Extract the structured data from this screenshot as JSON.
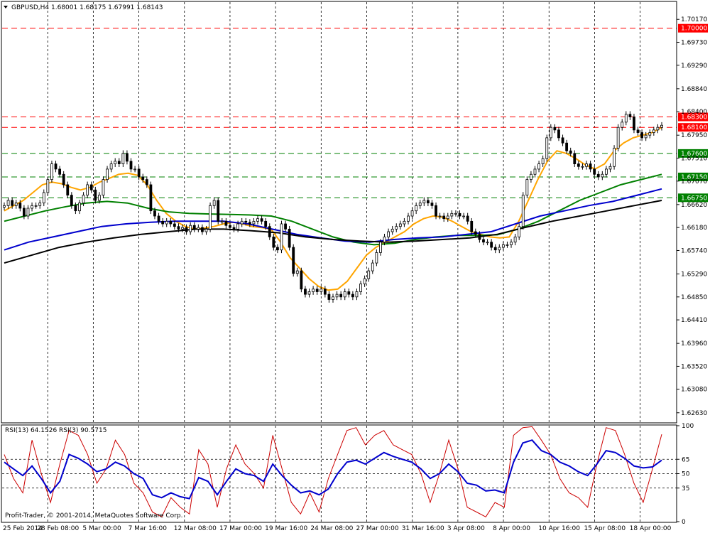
{
  "chart_data": [
    {
      "type": "candlestick",
      "title": "GBPUSD,H4  1.68001 1.68175 1.67991 1.68143",
      "symbol": "GBPUSD",
      "timeframe": "H4",
      "last_bar": {
        "open": 1.68001,
        "high": 1.68175,
        "low": 1.67991,
        "close": 1.68143
      },
      "ylim": [
        1.6245,
        1.705
      ],
      "y_ticks": [
        "1.70170",
        "1.69730",
        "1.69290",
        "1.68840",
        "1.68400",
        "1.67950",
        "1.67510",
        "1.67070",
        "1.66620",
        "1.66180",
        "1.65740",
        "1.65290",
        "1.64850",
        "1.64410",
        "1.63960",
        "1.63520",
        "1.63080",
        "1.62630"
      ],
      "x_ticks": [
        "25 Feb 2014",
        "28 Feb 08:00",
        "5 Mar 00:00",
        "7 Mar 16:00",
        "12 Mar 08:00",
        "17 Mar 00:00",
        "19 Mar 16:00",
        "24 Mar 08:00",
        "27 Mar 00:00",
        "31 Mar 16:00",
        "3 Apr 08:00",
        "8 Apr 00:00",
        "10 Apr 16:00",
        "15 Apr 08:00",
        "18 Apr 00:00"
      ],
      "levels": [
        {
          "label": "1.70000",
          "value": 1.7,
          "color": "#ff0000"
        },
        {
          "label": "1.68300",
          "value": 1.683,
          "color": "#ff0000"
        },
        {
          "label": "1.68100",
          "value": 1.681,
          "color": "#ff0000"
        },
        {
          "label": "1.67600",
          "value": 1.676,
          "color": "#008000"
        },
        {
          "label": "1.67150",
          "value": 1.6715,
          "color": "#008000"
        },
        {
          "label": "1.66750",
          "value": 1.6675,
          "color": "#008000"
        }
      ],
      "series": [
        {
          "kind": "candles",
          "values": [
            1.666,
            1.667,
            1.666,
            1.6665,
            1.6655,
            1.664,
            1.6655,
            1.666,
            1.666,
            1.6665,
            1.6685,
            1.671,
            1.674,
            1.673,
            1.672,
            1.67,
            1.668,
            1.666,
            1.665,
            1.6665,
            1.668,
            1.67,
            1.669,
            1.667,
            1.668,
            1.671,
            1.673,
            1.674,
            1.6745,
            1.674,
            1.676,
            1.6745,
            1.673,
            1.673,
            1.6715,
            1.671,
            1.67,
            1.665,
            1.664,
            1.663,
            1.6625,
            1.663,
            1.6625,
            1.662,
            1.6615,
            1.6618,
            1.661,
            1.6622,
            1.6615,
            1.6618,
            1.661,
            1.6615,
            1.666,
            1.667,
            1.663,
            1.663,
            1.6622,
            1.6618,
            1.6615,
            1.6625,
            1.663,
            1.6628,
            1.6625,
            1.663,
            1.6635,
            1.663,
            1.662,
            1.66,
            1.658,
            1.6575,
            1.6625,
            1.6615,
            1.658,
            1.653,
            1.6535,
            1.65,
            1.649,
            1.6495,
            1.65,
            1.6495,
            1.65,
            1.649,
            1.648,
            1.6485,
            1.649,
            1.6485,
            1.6495,
            1.649,
            1.6485,
            1.6495,
            1.651,
            1.652,
            1.6535,
            1.655,
            1.657,
            1.659,
            1.66,
            1.661,
            1.6615,
            1.662,
            1.6625,
            1.663,
            1.664,
            1.665,
            1.666,
            1.6665,
            1.667,
            1.6665,
            1.666,
            1.664,
            1.664,
            1.6635,
            1.664,
            1.6645,
            1.6645,
            1.664,
            1.664,
            1.663,
            1.661,
            1.6605,
            1.6595,
            1.659,
            1.659,
            1.658,
            1.6575,
            1.658,
            1.6585,
            1.6585,
            1.659,
            1.66,
            1.662,
            1.668,
            1.671,
            1.672,
            1.673,
            1.674,
            1.675,
            1.679,
            1.681,
            1.6805,
            1.679,
            1.678,
            1.6765,
            1.676,
            1.674,
            1.6735,
            1.6735,
            1.674,
            1.673,
            1.672,
            1.6715,
            1.672,
            1.673,
            1.6735,
            1.677,
            1.681,
            1.682,
            1.6835,
            1.683,
            1.6805,
            1.68,
            1.679,
            1.6795,
            1.68,
            1.6805,
            1.681,
            1.6814
          ]
        },
        {
          "name": "",
          "kind": "ma-fast",
          "color": "#ffa500",
          "values": [
            1.665,
            1.666,
            1.667,
            1.6685,
            1.67,
            1.6705,
            1.6702,
            1.6695,
            1.669,
            1.6695,
            1.6705,
            1.6712,
            1.672,
            1.6722,
            1.6718,
            1.67,
            1.667,
            1.6645,
            1.663,
            1.662,
            1.6615,
            1.6617,
            1.662,
            1.6625,
            1.6628,
            1.6625,
            1.662,
            1.6618,
            1.6615,
            1.659,
            1.656,
            1.654,
            1.652,
            1.6505,
            1.6498,
            1.65,
            1.6515,
            1.654,
            1.6565,
            1.658,
            1.659,
            1.66,
            1.661,
            1.6625,
            1.6635,
            1.664,
            1.6638,
            1.663,
            1.662,
            1.661,
            1.6605,
            1.66,
            1.6598,
            1.66,
            1.663,
            1.667,
            1.671,
            1.6745,
            1.6765,
            1.676,
            1.675,
            1.6738,
            1.673,
            1.674,
            1.6765,
            1.678,
            1.679,
            1.6795,
            1.68,
            1.681
          ]
        },
        {
          "name": "",
          "kind": "ma-mid",
          "color": "#008000",
          "values": [
            1.663,
            1.664,
            1.665,
            1.6658,
            1.6665,
            1.6668,
            1.6665,
            1.6655,
            1.6648,
            1.6645,
            1.6644,
            1.6643,
            1.6642,
            1.664,
            1.663,
            1.6615,
            1.66,
            1.659,
            1.6585,
            1.6588,
            1.6595,
            1.66,
            1.6603,
            1.6603,
            1.6604,
            1.6615,
            1.663,
            1.665,
            1.667,
            1.6685,
            1.67,
            1.671,
            1.672
          ]
        },
        {
          "name": "",
          "kind": "ma-slow-1",
          "color": "#0000cd",
          "values": [
            1.6575,
            1.659,
            1.66,
            1.661,
            1.662,
            1.6625,
            1.6628,
            1.663,
            1.663,
            1.663,
            1.6625,
            1.6615,
            1.6605,
            1.6598,
            1.6592,
            1.659,
            1.6595,
            1.6598,
            1.66,
            1.6605,
            1.661,
            1.6625,
            1.664,
            1.665,
            1.666,
            1.6668,
            1.668,
            1.6692
          ]
        },
        {
          "name": "",
          "kind": "ma-slow-2",
          "color": "#000000",
          "values": [
            1.655,
            1.6565,
            1.658,
            1.659,
            1.6598,
            1.6605,
            1.661,
            1.6615,
            1.6615,
            1.6612,
            1.6608,
            1.66,
            1.6595,
            1.6592,
            1.659,
            1.6592,
            1.6595,
            1.6598,
            1.6605,
            1.6618,
            1.663,
            1.664,
            1.665,
            1.666,
            1.667
          ]
        }
      ]
    },
    {
      "type": "line",
      "title": "RSI(13) 64.1526  RSI(3) 90.5715",
      "ylim": [
        0,
        100
      ],
      "y_ticks": [
        "100",
        "65",
        "50",
        "35",
        "0"
      ],
      "levels": [
        65,
        50,
        35
      ],
      "series": [
        {
          "name": "RSI(13)",
          "color": "#0000cd",
          "values": [
            62,
            55,
            48,
            58,
            45,
            30,
            42,
            70,
            66,
            60,
            52,
            55,
            62,
            58,
            50,
            45,
            28,
            25,
            30,
            26,
            24,
            46,
            42,
            28,
            42,
            55,
            50,
            48,
            42,
            60,
            48,
            38,
            30,
            32,
            28,
            34,
            50,
            62,
            64,
            60,
            66,
            72,
            68,
            65,
            62,
            55,
            45,
            50,
            60,
            52,
            40,
            38,
            32,
            33,
            30,
            62,
            82,
            85,
            74,
            70,
            62,
            58,
            52,
            48,
            60,
            74,
            72,
            66,
            58,
            56,
            57,
            64
          ]
        },
        {
          "name": "RSI(3)",
          "color": "#cc0000",
          "values": [
            70,
            45,
            30,
            85,
            50,
            20,
            60,
            95,
            90,
            70,
            40,
            55,
            85,
            70,
            40,
            30,
            10,
            5,
            25,
            15,
            8,
            75,
            60,
            15,
            55,
            80,
            60,
            50,
            35,
            90,
            55,
            20,
            8,
            30,
            10,
            45,
            70,
            95,
            98,
            80,
            90,
            95,
            80,
            75,
            70,
            50,
            20,
            50,
            85,
            55,
            15,
            10,
            5,
            20,
            15,
            90,
            98,
            99,
            85,
            70,
            45,
            30,
            25,
            15,
            60,
            98,
            95,
            70,
            40,
            20,
            55,
            91
          ]
        }
      ]
    }
  ],
  "watermark": "Profit-Trader, © 2001-2014, MetaQuotes Software Corp."
}
